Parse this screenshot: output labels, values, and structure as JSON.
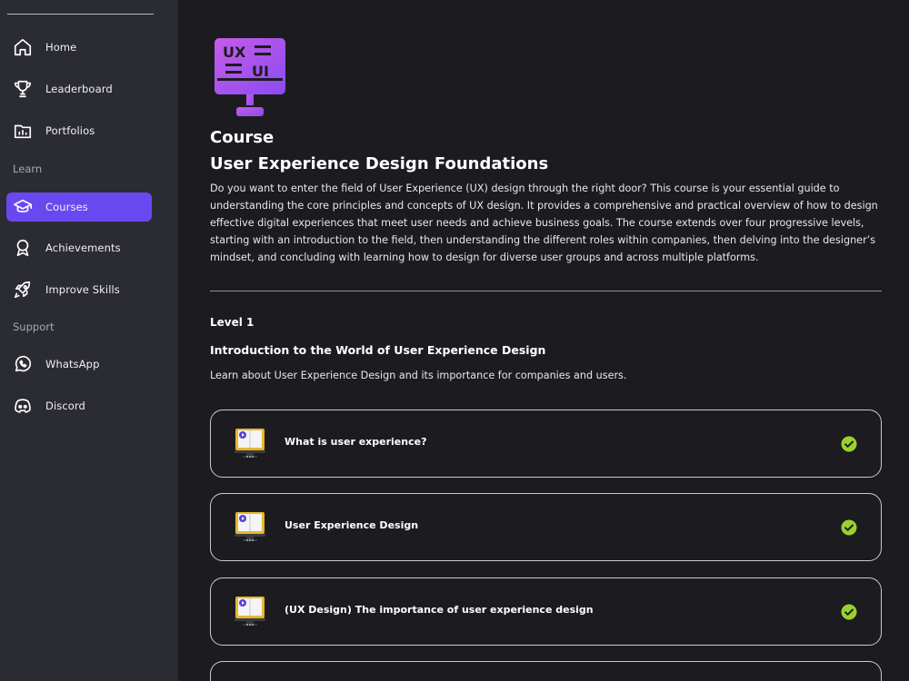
{
  "sidebar": {
    "items": [
      {
        "label": "Home",
        "icon": "home-icon"
      },
      {
        "label": "Leaderboard",
        "icon": "trophy-icon"
      },
      {
        "label": "Portfolios",
        "icon": "portfolio-icon"
      },
      {
        "label": "Courses",
        "icon": "graduation-cap-icon",
        "active": true
      },
      {
        "label": "Achievements",
        "icon": "medal-icon"
      },
      {
        "label": "Improve Skills",
        "icon": "rocket-icon"
      },
      {
        "label": "WhatsApp",
        "icon": "whatsapp-icon"
      },
      {
        "label": "Discord",
        "icon": "discord-icon"
      }
    ],
    "sections": {
      "learn": "Learn",
      "support": "Support"
    }
  },
  "course": {
    "kicker": "Course",
    "title": "User Experience Design Foundations",
    "description": "Do you want to enter the field of User Experience (UX) design through the right door? This course is your essential guide to understanding the core principles and concepts of UX design. It provides a comprehensive and practical overview of how to design effective digital experiences that meet user needs and achieve business goals. The course extends over four progressive levels, starting with an introduction to the field, then understanding the different roles within companies, then delving into the designer’s mindset, and concluding with learning how to design for diverse user groups and across multiple platforms.",
    "hero_icon": "ux-ui-monitor-icon"
  },
  "level": {
    "label": "Level 1",
    "title": "Introduction to the World of User Experience Design",
    "description": "Learn about User Experience Design and its importance for companies and users."
  },
  "lessons": [
    {
      "title": "What is user experience?",
      "completed": true
    },
    {
      "title": "User Experience Design",
      "completed": true
    },
    {
      "title": "(UX Design) The importance of user experience design",
      "completed": true
    }
  ],
  "colors": {
    "accent": "#6a48f0",
    "check": "#9bd12f",
    "sidebar_bg": "#2a2b33",
    "main_bg": "#1c1c20"
  }
}
